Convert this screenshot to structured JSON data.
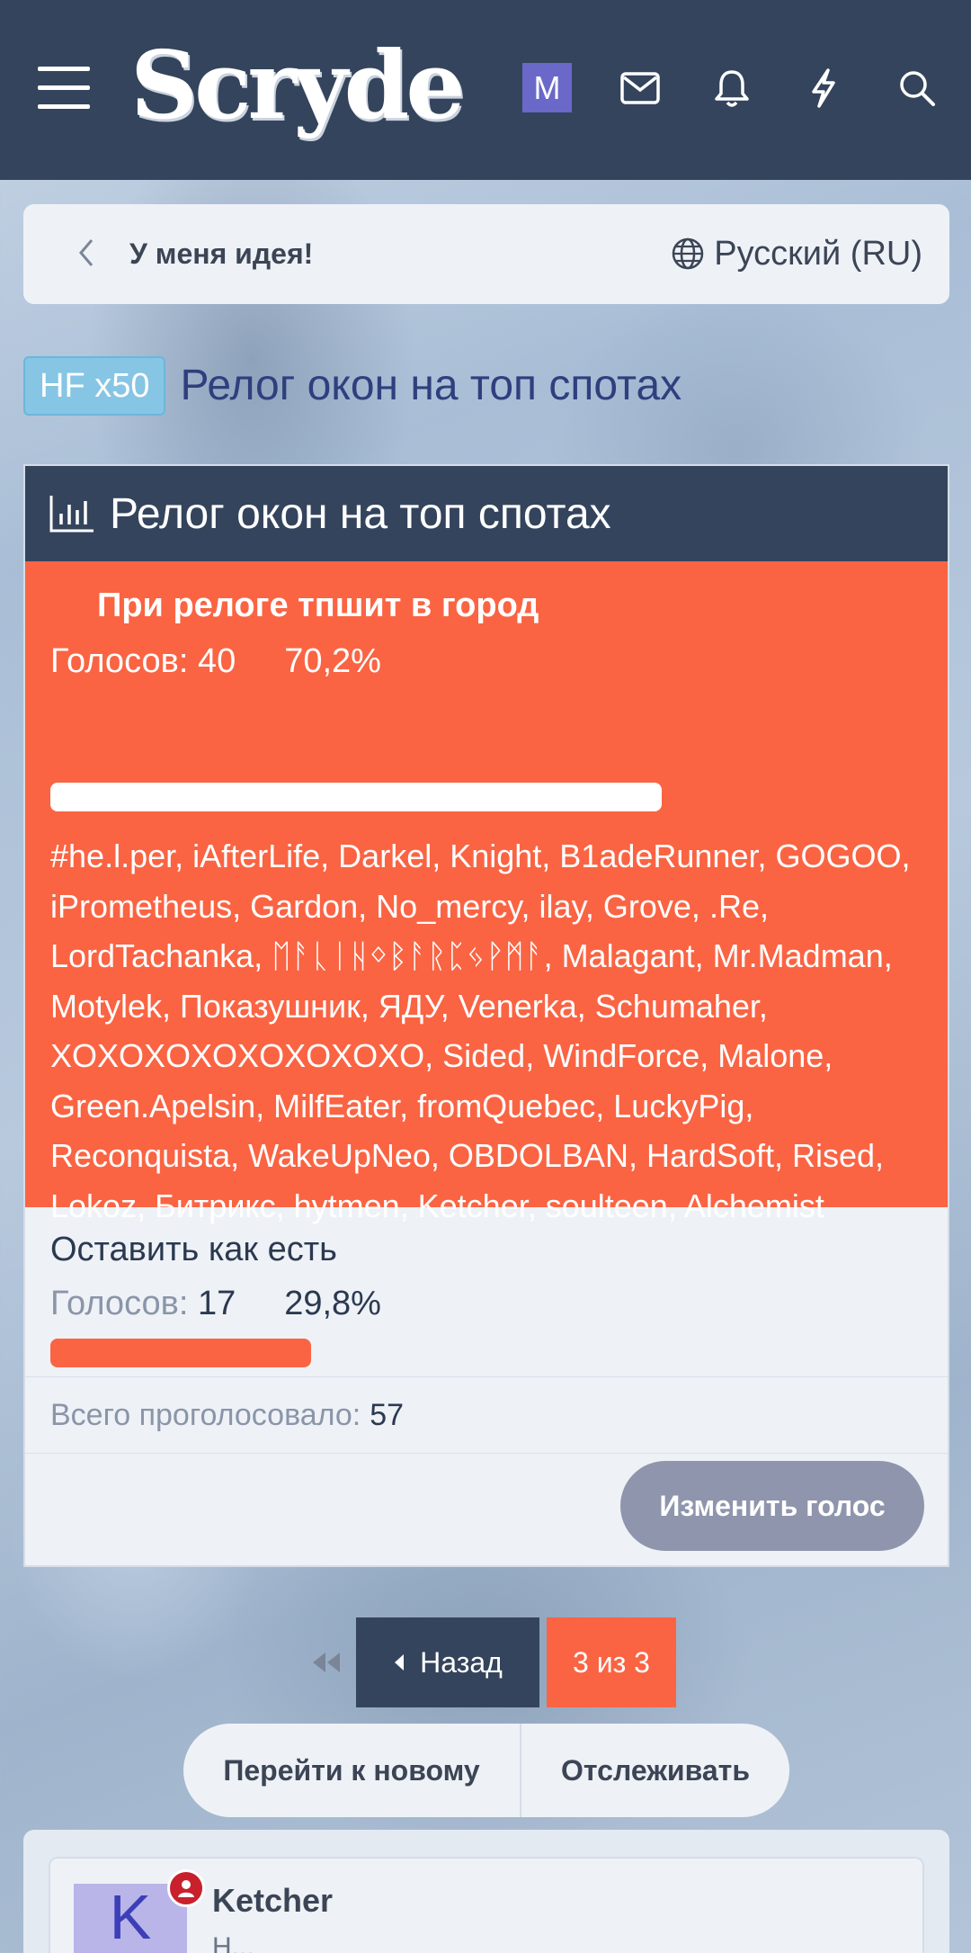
{
  "header": {
    "logo_text": "Scryde",
    "user_avatar_letter": "M"
  },
  "breadcrumb": {
    "label": "У меня идея!",
    "language": "Русский (RU)"
  },
  "thread": {
    "prefix": "HF x50",
    "title": "Релог окон на топ спотах"
  },
  "poll": {
    "title": "Релог окон на топ спотах",
    "options": [
      {
        "name": "При релоге тпшит в город",
        "votes_label": "Голосов:",
        "votes": "40",
        "percent": "70,2%",
        "fraction": 0.702,
        "voters": "#he.l.per, iAfterLife, Darkel, Knight, B1adeRunner, GOGOO, iPrometheus, Gardon, No_mercy, ilay, Grove, .Re, LordTachanka, ᛖᚨᚳᛁᚺᛜᛒᚨᚱᛈᛃᚹᛗᚨ, Malagant, Mr.Madman, Motylek, Показушник, ЯДУ, Venerka, Schumaher, XOXOXOXOXOXOXOXO, Sided, WindForce, Malone, Green.Apelsin, MilfEater, fromQuebec, LuckyPig, Reconquista, WakeUpNeo, OBDOLBAN, HardSoft, Rised, Lokoz, Битрикс, hytmen, Ketcher, soulteen, Alchemist"
      },
      {
        "name": "Оставить как есть",
        "votes_label": "Голосов:",
        "votes": "17",
        "percent": "29,8%",
        "fraction": 0.298
      }
    ],
    "total_label": "Всего проголосовало:",
    "total": "57",
    "change_vote": "Изменить голос"
  },
  "pager": {
    "prev_label": "Назад",
    "current": "3 из 3"
  },
  "actions": {
    "go_to_new": "Перейти к новому",
    "watch": "Отслеживать"
  },
  "post": {
    "avatar_letter": "K",
    "username": "Ketcher",
    "subtitle": "Н..."
  },
  "colors": {
    "header_bg": "#34445c",
    "accent": "#fa6443",
    "prefix_bg": "#86c5e4"
  }
}
